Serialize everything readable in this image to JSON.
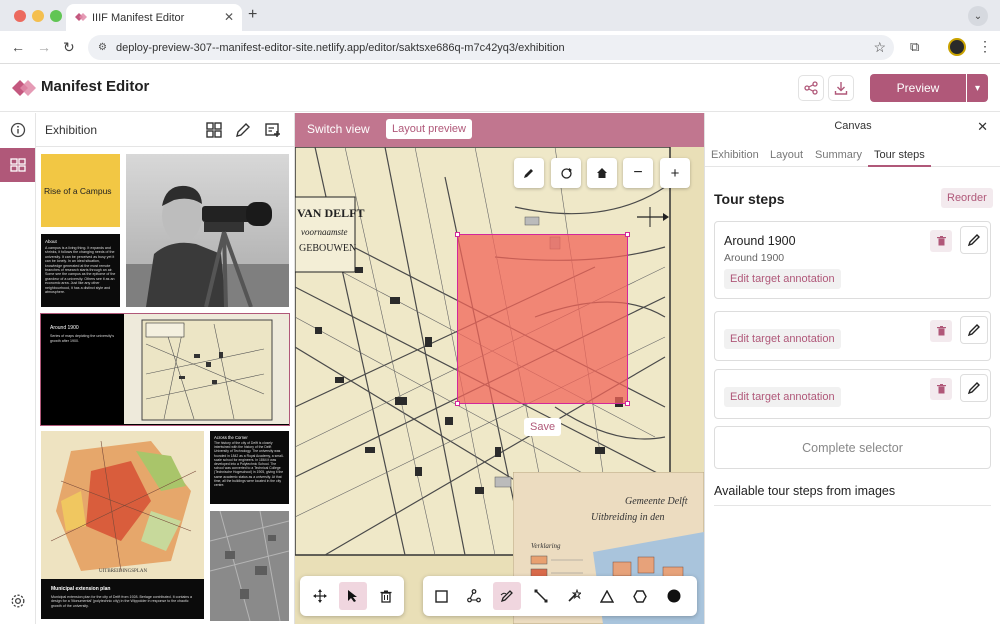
{
  "browser": {
    "tab_title": "IIIF Manifest Editor",
    "url": "deploy-preview-307--manifest-editor-site.netlify.app/editor/saktsxe686q-m7c42yq3/exhibition"
  },
  "app": {
    "title": "Manifest Editor",
    "preview_label": "Preview",
    "brand_color": "#b05879"
  },
  "left_panel": {
    "title": "Exhibition",
    "thumbs": {
      "rise_title": "Rise of a Campus",
      "about_heading": "About",
      "about_text": "A campus is a living thing. It expands and shrinks, it follows the changing needs of the university. It can be perceived as busy yet it can be lonely. In an ideal situation, knowledge generated at the most remote branches of research starts through an air. Some see the campus as the epitome of the grandeur of a university. Others see it as an economic area. Just like any other neighbourhood, it has a distinct style and atmosphere.",
      "around_heading": "Around 1900",
      "around_text": "Series of maps depicting the university's growth after 1900.",
      "across_heading": "Across the Corner",
      "across_text": "The history of the city of Delft is closely intertwined with the history of the Delft University of Technology. The university was founded in 1842 as a Royal Academy, a small-scale school for engineers. In 1864 it was developed into a Polytechnic School. The school was converted to a Technical College (Technische Hogeschool) in 1905, giving it the same academic status as a university. At that time, all the buildings were located in the city centre.",
      "municipal_heading": "Municipal extension plan",
      "municipal_text": "Municipal extension plan for the city of Delft from 1928. Berlage contributed. It contains a design for a 'Monumental' (polytechnic city) in the Wippolder in response to the chaotic growth of the university.",
      "map_label": "UITBREIDINGSPLAN"
    }
  },
  "center": {
    "switch_view": "Switch view",
    "layout_preview": "Layout preview",
    "save_label": "Save",
    "map_text_1": "VAN DELFT",
    "map_text_2": "voornaamste",
    "map_text_3": "GEBOUWEN",
    "map2_text_1": "Gemeente Delft",
    "map2_text_2": "Uitbreiding in den",
    "map2_legend": "Verklaring"
  },
  "right_panel": {
    "header": "Canvas",
    "tabs": [
      "Exhibition",
      "Layout",
      "Summary",
      "Tour steps"
    ],
    "section_title": "Tour steps",
    "reorder_label": "Reorder",
    "steps": [
      {
        "title": "Around 1900",
        "subtitle": "Around 1900",
        "action": "Edit target annotation"
      },
      {
        "title": "",
        "subtitle": "",
        "action": "Edit target annotation"
      },
      {
        "title": "",
        "subtitle": "",
        "action": "Edit target annotation"
      }
    ],
    "complete_selector": "Complete selector",
    "available_title": "Available tour steps from images"
  }
}
